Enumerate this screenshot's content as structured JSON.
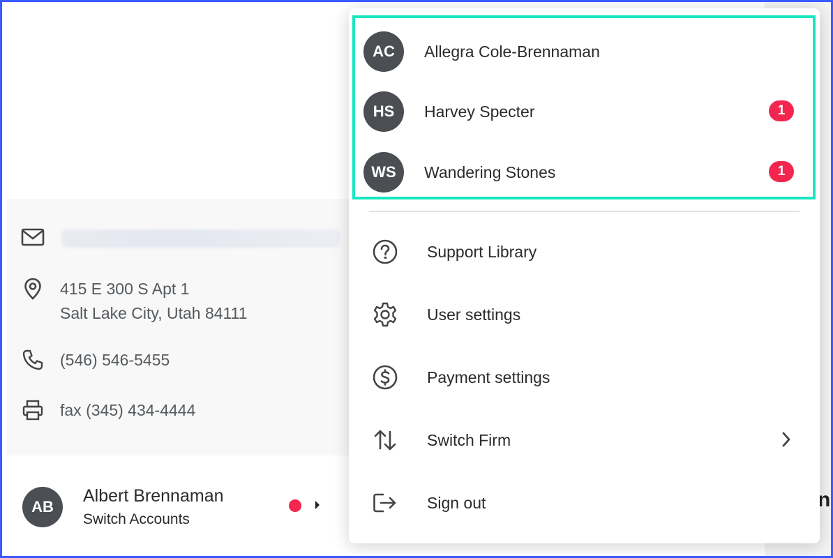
{
  "contact": {
    "address_line1": "415 E 300 S Apt 1",
    "address_line2": "Salt Lake City, Utah 84111",
    "phone": "(546) 546-5455",
    "fax": "fax (345) 434-4444"
  },
  "user": {
    "initials": "AB",
    "name": "Albert Brennaman",
    "sub": "Switch Accounts"
  },
  "accounts": [
    {
      "initials": "AC",
      "name": "Allegra Cole-Brennaman",
      "badge": ""
    },
    {
      "initials": "HS",
      "name": "Harvey Specter",
      "badge": "1"
    },
    {
      "initials": "WS",
      "name": "Wandering Stones",
      "badge": "1"
    }
  ],
  "menu": {
    "support": "Support Library",
    "user_settings": "User settings",
    "payment_settings": "Payment settings",
    "switch_firm": "Switch Firm",
    "sign_out": "Sign out"
  },
  "background": {
    "heading_fragment": "n"
  },
  "colors": {
    "highlight": "#19e6c1",
    "badge": "#f2264f",
    "avatar": "#4b4e53",
    "frame": "#3b5bff"
  }
}
